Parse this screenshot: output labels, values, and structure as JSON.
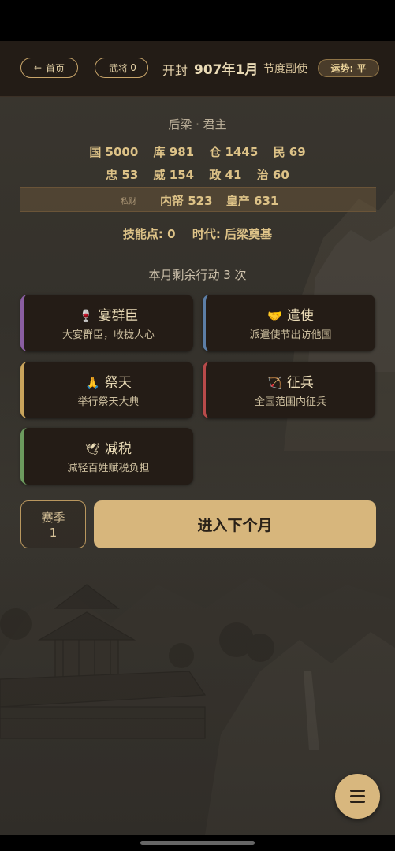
{
  "header": {
    "home_label": "首页",
    "home_arrow": "←",
    "generals_label": "武将",
    "generals_count": "0",
    "city": "开封",
    "date": "907年1月",
    "title": "节度副使",
    "luck": "运势: 平"
  },
  "status": {
    "dynasty": "后梁 · 君主",
    "stats_row1": [
      "国 5000",
      "库 981",
      "仓 1445",
      "民 69"
    ],
    "stats_row2": [
      "忠 53",
      "威 154",
      "政 41",
      "治 60"
    ],
    "private_label": "私财",
    "private_values": [
      "内帑 523",
      "皇产 631"
    ],
    "skill_points": "技能点: 0",
    "era": "时代: 后梁奠基",
    "remaining_actions": "本月剩余行动 3 次"
  },
  "actions": [
    {
      "icon": "🍷",
      "title": "宴群臣",
      "desc": "大宴群臣，收拢人心",
      "color": "#8a5ea1"
    },
    {
      "icon": "🤝",
      "title": "遣使",
      "desc": "派遣使节出访他国",
      "color": "#5c7ea6"
    },
    {
      "icon": "🙏",
      "title": "祭天",
      "desc": "举行祭天大典",
      "color": "#c9a45c"
    },
    {
      "icon": "🏹",
      "title": "征兵",
      "desc": "全国范围内征兵",
      "color": "#b84a4a"
    },
    {
      "icon": "🕊",
      "title": "减税",
      "desc": "减轻百姓赋税负担",
      "color": "#6c9a5e"
    }
  ],
  "footer": {
    "season_label": "赛季",
    "season_value": "1",
    "next_month": "进入下个月"
  },
  "colors": {
    "accent": "#d7b67c",
    "header_bg": "#231c16",
    "card_bg": "#241c16"
  }
}
